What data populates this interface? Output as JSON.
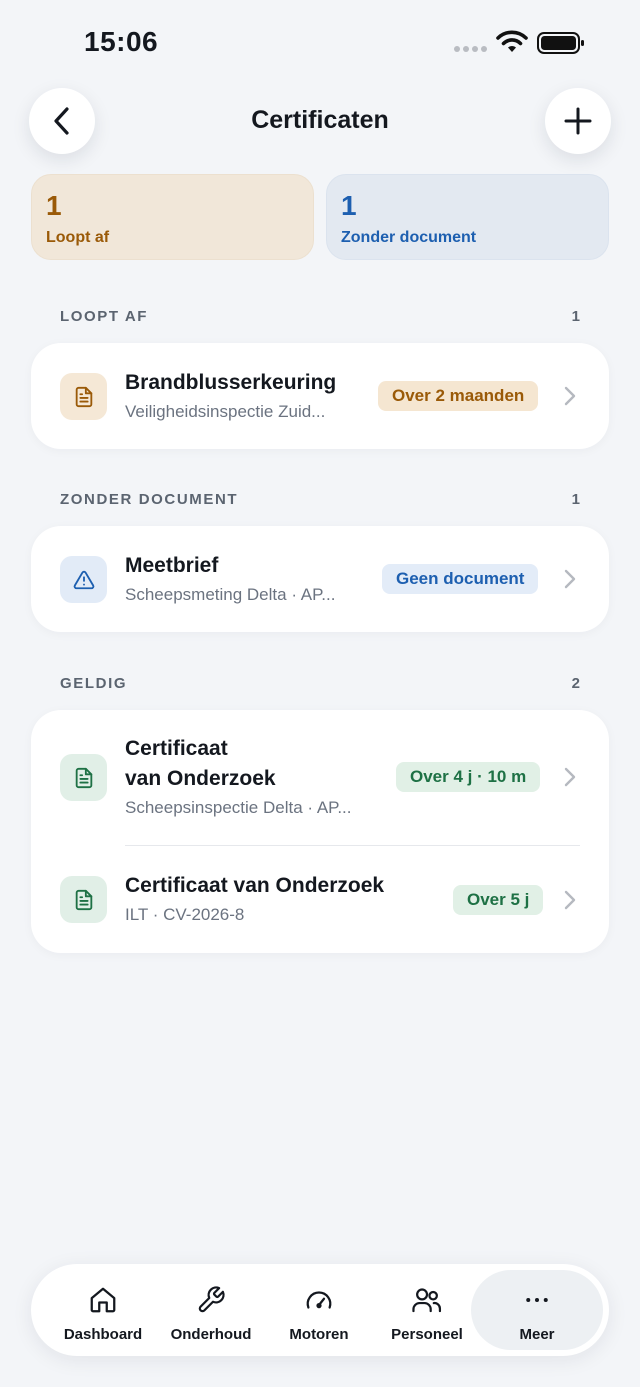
{
  "status_bar": {
    "time": "15:06"
  },
  "header": {
    "title": "Certificaten"
  },
  "summary": {
    "expiring": {
      "count": "1",
      "label": "Loopt af"
    },
    "no_document": {
      "count": "1",
      "label": "Zonder document"
    }
  },
  "sections": {
    "expiring": {
      "title": "LOOPT AF",
      "count": "1",
      "items": [
        {
          "title": "Brandblusserkeuring",
          "subtitle": "Veiligheidsinspectie Zuid...",
          "badge": "Over 2 maanden"
        }
      ]
    },
    "no_document": {
      "title": "ZONDER DOCUMENT",
      "count": "1",
      "items": [
        {
          "title": "Meetbrief",
          "subtitle": "Scheepsmeting Delta · AP...",
          "badge": "Geen document"
        }
      ]
    },
    "valid": {
      "title": "GELDIG",
      "count": "2",
      "items": [
        {
          "title_line1": "Certificaat",
          "title_line2": "van Onderzoek",
          "subtitle": "Scheepsinspectie Delta · AP...",
          "badge": "Over 4 j · 10 m"
        },
        {
          "title": "Certificaat van Onderzoek",
          "subtitle": "ILT · CV-2026-8",
          "badge": "Over 5 j"
        }
      ]
    }
  },
  "tab_bar": {
    "tabs": [
      {
        "label": "Dashboard",
        "icon": "home-icon"
      },
      {
        "label": "Onderhoud",
        "icon": "wrench-icon"
      },
      {
        "label": "Motoren",
        "icon": "gauge-icon"
      },
      {
        "label": "Personeel",
        "icon": "people-icon"
      },
      {
        "label": "Meer",
        "icon": "more-icon"
      }
    ],
    "active": "Meer"
  },
  "colors": {
    "background": "#f3f5f8",
    "amber": "#9a5a08",
    "blue": "#1d5fb0",
    "green": "#1e7145"
  }
}
